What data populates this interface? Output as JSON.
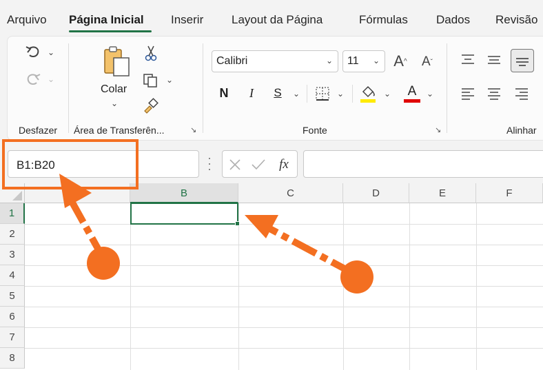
{
  "tabs": [
    "Arquivo",
    "Página Inicial",
    "Inserir",
    "Layout da Página",
    "Fórmulas",
    "Dados",
    "Revisão"
  ],
  "active_tab": "Página Inicial",
  "ribbon": {
    "groups": {
      "undo": "Desfazer",
      "clipboard": "Área de Transferên...",
      "font": "Fonte",
      "alignment": "Alinhar"
    },
    "paste_label": "Colar",
    "font_name": "Calibri",
    "font_size": "11",
    "bold": "N",
    "italic": "I",
    "underline": "S",
    "grow_font": "A",
    "shrink_font": "A",
    "font_color": "A"
  },
  "formula_bar": {
    "name_box": "B1:B20",
    "fx": "fx",
    "formula": ""
  },
  "grid": {
    "columns": [
      "B",
      "C",
      "D",
      "E",
      "F"
    ],
    "selected_column": "B",
    "rows": [
      "1",
      "2",
      "3",
      "4",
      "5",
      "6",
      "7",
      "8"
    ],
    "selected_row": "1",
    "active_cell": "B1"
  },
  "colors": {
    "accent": "#217346",
    "annotation": "#f36f21",
    "fill_yellow": "#ffeb00",
    "font_red": "#e00000"
  }
}
